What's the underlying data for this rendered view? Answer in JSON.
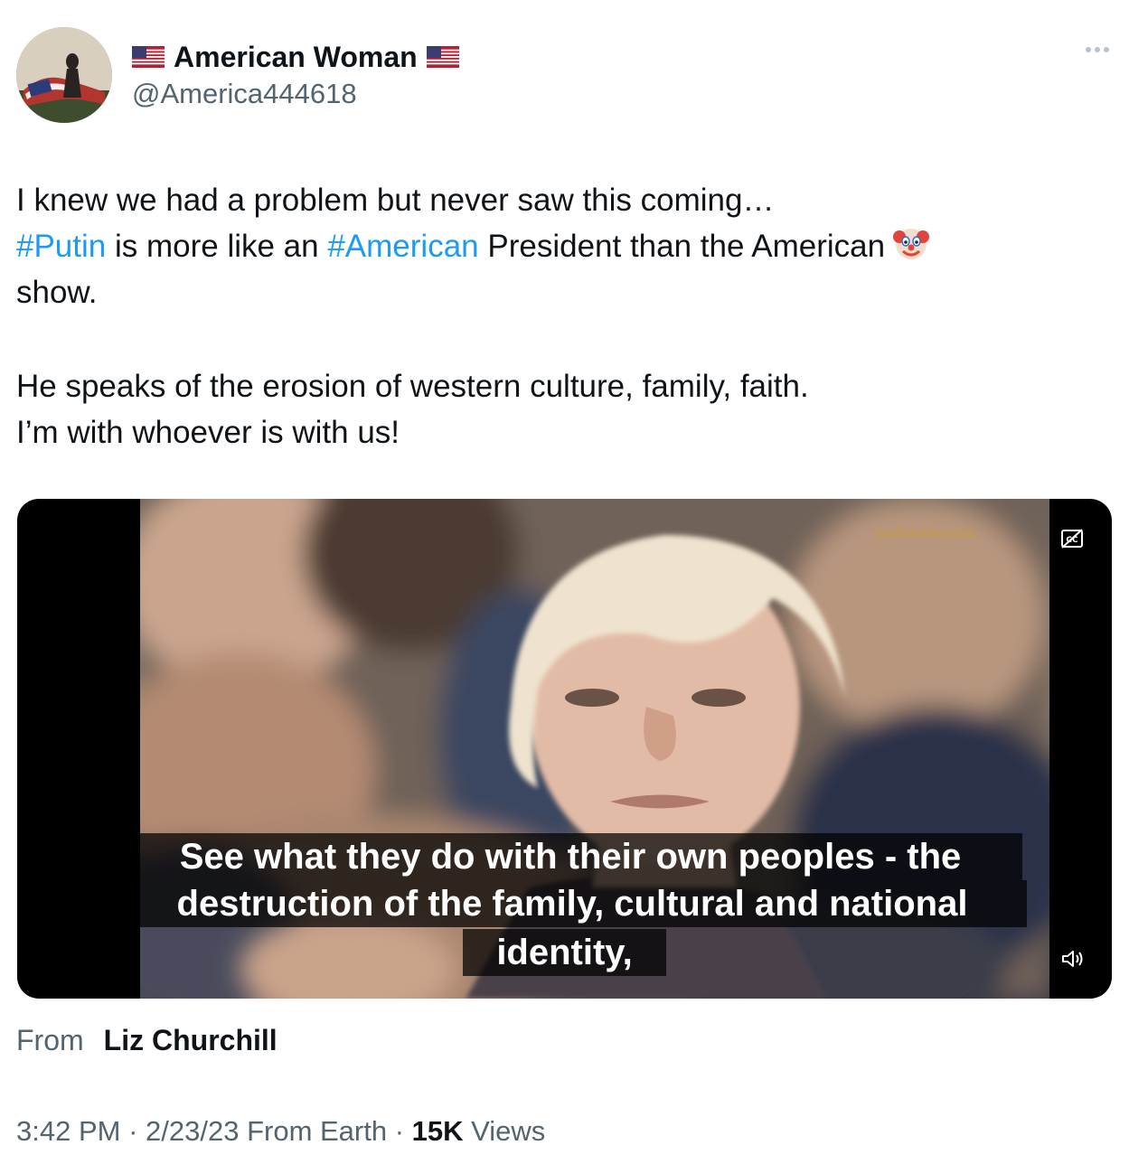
{
  "author": {
    "display_name": "American Woman",
    "handle": "@America444618",
    "name_prefix_icon": "us-flag-icon",
    "name_suffix_icon": "us-flag-icon"
  },
  "tweet": {
    "line1": "I knew we had a problem but never saw this coming…",
    "hashtag_putin": "#Putin",
    "line2_mid": " is more like an ",
    "hashtag_american": "#American",
    "line2_end": " President than the American",
    "line2_emoji": "clown-face-icon",
    "line3": "show.",
    "line4": "He speaks of the erosion of western culture, family, faith.",
    "line5": "I’m with whoever is with us!"
  },
  "video": {
    "watermark": "me/IntelRepublic",
    "subtitle_line1": "See what they do with their own peoples - the",
    "subtitle_line2": "destruction of the family, cultural and national",
    "subtitle_line3": "identity,",
    "cc_icon": "closed-captions-icon",
    "volume_icon": "volume-icon"
  },
  "attribution": {
    "label": "From",
    "name": "Liz Churchill"
  },
  "meta": {
    "time": "3:42 PM",
    "sep1": " · ",
    "date": "2/23/23",
    "source": " From Earth",
    "sep2": " · ",
    "views_count": "15K",
    "views_label": " Views"
  },
  "colors": {
    "link": "#1d9bf0",
    "secondary_text": "#536471",
    "primary_text": "#0f1419"
  }
}
